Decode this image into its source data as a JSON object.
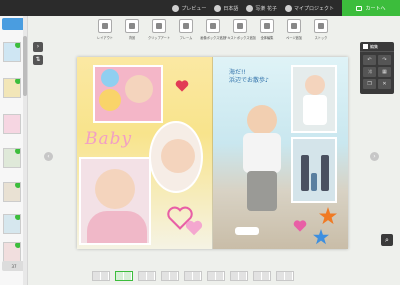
{
  "topbar": {
    "preview_label": "プレビュー",
    "language_label": "日本語",
    "user_label": "写楽 花子",
    "mypage_label": "マイプロジェクト",
    "order_label": "カートへ"
  },
  "sidebar": {
    "page_count": "37"
  },
  "toolbar": {
    "items": [
      {
        "label": "レイアウト",
        "icon": "layout-icon"
      },
      {
        "label": "背景",
        "icon": "background-icon"
      },
      {
        "label": "クリップアート",
        "icon": "clipart-icon"
      },
      {
        "label": "フレーム",
        "icon": "frame-icon"
      },
      {
        "label": "画像ボックス追加",
        "icon": "add-image-icon"
      },
      {
        "label": "テキストボックス追加",
        "icon": "add-text-icon"
      },
      {
        "label": "全体編集",
        "icon": "edit-all-icon"
      },
      {
        "label": "ページ追加",
        "icon": "add-page-icon"
      },
      {
        "label": "ストック",
        "icon": "stock-icon"
      }
    ]
  },
  "album": {
    "baby_text": "Baby",
    "jp_caption_line1": "海だ!!",
    "jp_caption_line2": "浜辺でお散歩♪"
  },
  "right_panel": {
    "title": "編集"
  },
  "colors": {
    "topbar": "#2b2b2b",
    "order_button": "#3cbd3c",
    "accent_blue": "#4a9de0"
  }
}
